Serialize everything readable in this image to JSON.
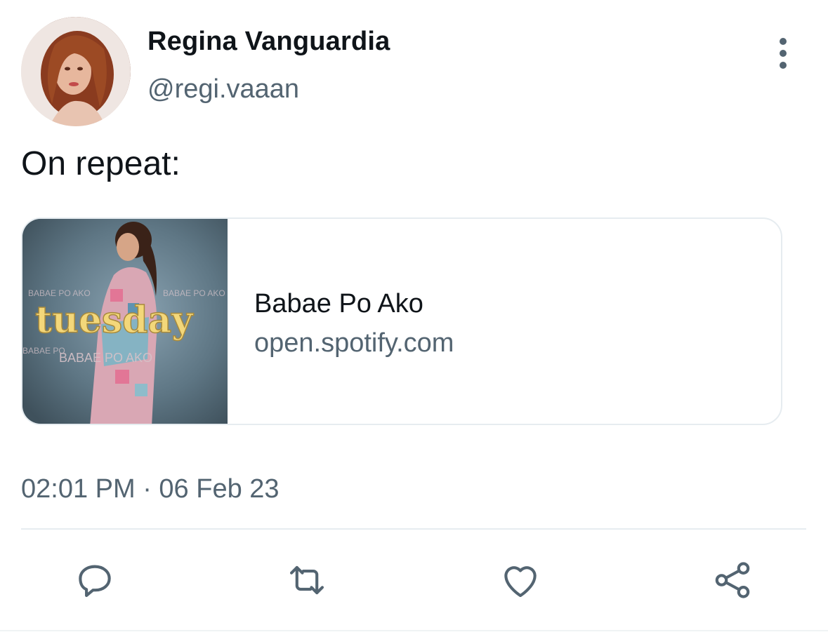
{
  "user": {
    "display_name": "Regina Vanguardia",
    "handle": "@regi.vaaan",
    "avatar_icon": "profile-photo"
  },
  "tweet": {
    "text": "On repeat:",
    "timestamp": "02:01 PM · 06 Feb 23"
  },
  "link_card": {
    "thumbnail_word": "tuesday",
    "thumbnail_subtitle": "BABAE PO AKO",
    "title": "Babae Po Ako",
    "domain": "open.spotify.com"
  },
  "actions": {
    "more_icon": "more-vertical-icon",
    "reply_icon": "reply-icon",
    "retweet_icon": "retweet-icon",
    "like_icon": "heart-icon",
    "share_icon": "share-icon"
  },
  "colors": {
    "text_primary": "#0f1419",
    "text_secondary": "#536471",
    "divider": "#e6ecf0",
    "card_word_yellow": "#f3d77a"
  }
}
